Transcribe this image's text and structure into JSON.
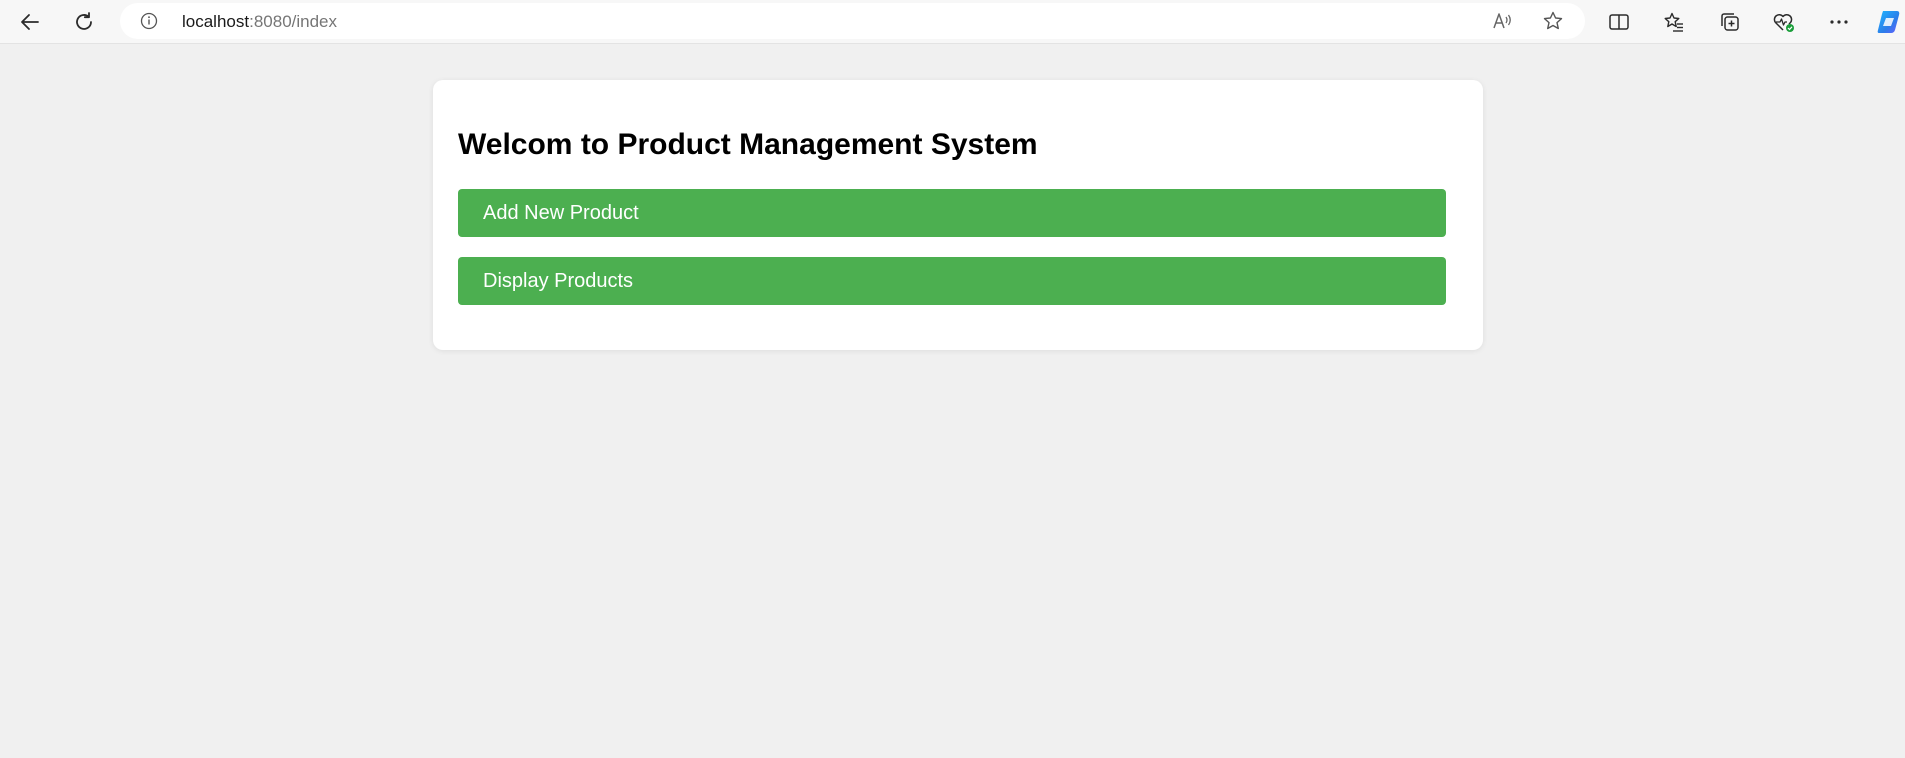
{
  "browser": {
    "url_host": "localhost",
    "url_path": ":8080/index",
    "icons": {
      "back": "back-arrow-icon",
      "refresh": "refresh-icon",
      "info": "info-icon",
      "read_aloud": "read-aloud-icon",
      "favorite": "star-icon",
      "split_screen": "split-screen-icon",
      "favorites": "favorites-icon",
      "collections": "collections-icon",
      "browser_essentials": "heart-pulse-icon",
      "more": "more-icon",
      "copilot": "copilot-icon"
    }
  },
  "page": {
    "title": "Welcom to Product Management System",
    "buttons": {
      "add_label": "Add New Product",
      "display_label": "Display Products"
    }
  },
  "colors": {
    "page_background": "#f0f0f0",
    "card_background": "#ffffff",
    "button_green": "#4caf50",
    "button_text": "#ffffff"
  }
}
